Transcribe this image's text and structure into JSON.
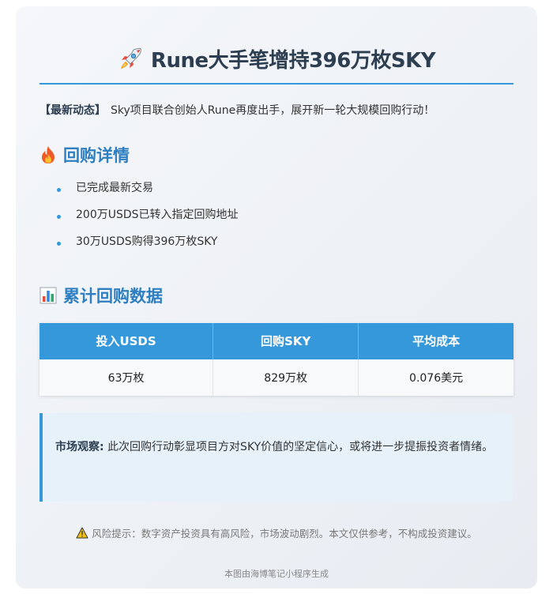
{
  "title": "Rune大手笔增持396万枚SKY",
  "news": {
    "tag": "【最新动态】",
    "text": "Sky项目联合创始人Rune再度出手，展开新一轮大规模回购行动！"
  },
  "details": {
    "title": "回购详情",
    "items": [
      "已完成最新交易",
      "200万USDS已转入指定回购地址",
      "30万USDS购得396万枚SKY"
    ]
  },
  "stats": {
    "title": "累计回购数据",
    "headers": [
      "投入USDS",
      "回购SKY",
      "平均成本"
    ],
    "row": [
      "63万枚",
      "829万枚",
      "0.076美元"
    ]
  },
  "observation": {
    "label": "市场观察:",
    "text": "此次回购行动彰显项目方对SKY价值的坚定信心，或将进一步提振投资者情绪。"
  },
  "risk": "风险提示：数字资产投资具有高风险，市场波动剧烈。本文仅供参考，不构成投资建议。",
  "footer": "本图由海博笔记小程序生成",
  "colors": {
    "accent": "#3498db",
    "section_title": "#2d7fc1",
    "observe_bg": "#e6f1fa"
  },
  "icons": {
    "title": "rocket-icon",
    "details": "fire-icon",
    "stats": "bar-chart-icon",
    "risk": "warning-icon"
  }
}
